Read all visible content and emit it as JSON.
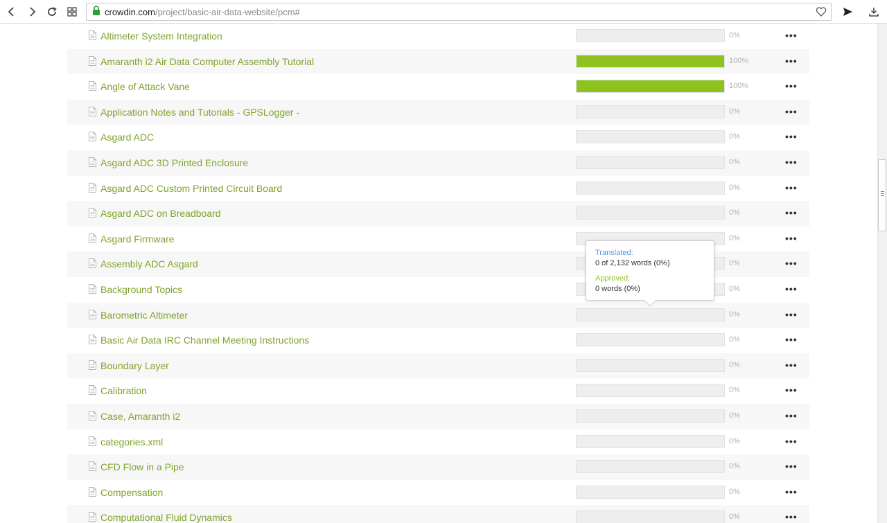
{
  "browser": {
    "url_host": "crowdin.com",
    "url_path": "/project/basic-air-data-website/pcm#"
  },
  "colors": {
    "link": "#7fa32a",
    "progress_fill": "#8dc21f",
    "translated_label": "#5b9bd5",
    "approved_label": "#8dc21f"
  },
  "files": [
    {
      "name": "Altimeter System Integration",
      "percent": 0,
      "percent_label": "0%"
    },
    {
      "name": "Amaranth i2 Air Data Computer Assembly Tutorial",
      "percent": 100,
      "percent_label": "100%"
    },
    {
      "name": "Angle of Attack Vane",
      "percent": 100,
      "percent_label": "100%"
    },
    {
      "name": "Application Notes and Tutorials - GPSLogger -",
      "percent": 0,
      "percent_label": "0%"
    },
    {
      "name": "Asgard ADC",
      "percent": 0,
      "percent_label": "0%"
    },
    {
      "name": "Asgard ADC 3D Printed Enclosure",
      "percent": 0,
      "percent_label": "0%"
    },
    {
      "name": "Asgard ADC Custom Printed Circuit Board",
      "percent": 0,
      "percent_label": "0%"
    },
    {
      "name": "Asgard ADC on Breadboard",
      "percent": 0,
      "percent_label": "0%"
    },
    {
      "name": "Asgard Firmware",
      "percent": 0,
      "percent_label": "0%"
    },
    {
      "name": "Assembly ADC Asgard",
      "percent": 0,
      "percent_label": "0%"
    },
    {
      "name": "Background Topics",
      "percent": 0,
      "percent_label": "0%"
    },
    {
      "name": "Barometric Altimeter",
      "percent": 0,
      "percent_label": "0%"
    },
    {
      "name": "Basic Air Data IRC Channel Meeting Instructions",
      "percent": 0,
      "percent_label": "0%"
    },
    {
      "name": "Boundary Layer",
      "percent": 0,
      "percent_label": "0%"
    },
    {
      "name": "Calibration",
      "percent": 0,
      "percent_label": "0%"
    },
    {
      "name": "Case, Amaranth i2",
      "percent": 0,
      "percent_label": "0%"
    },
    {
      "name": "categories.xml",
      "percent": 0,
      "percent_label": "0%"
    },
    {
      "name": "CFD Flow in a Pipe",
      "percent": 0,
      "percent_label": "0%"
    },
    {
      "name": "Compensation",
      "percent": 0,
      "percent_label": "0%"
    },
    {
      "name": "Computational Fluid Dynamics",
      "percent": 0,
      "percent_label": "0%"
    }
  ],
  "more_label": "•••",
  "tooltip": {
    "translated_label": "Translated:",
    "translated_value": "0 of 2,132 words (0%)",
    "approved_label": "Approved:",
    "approved_value": "0 words (0%)"
  }
}
